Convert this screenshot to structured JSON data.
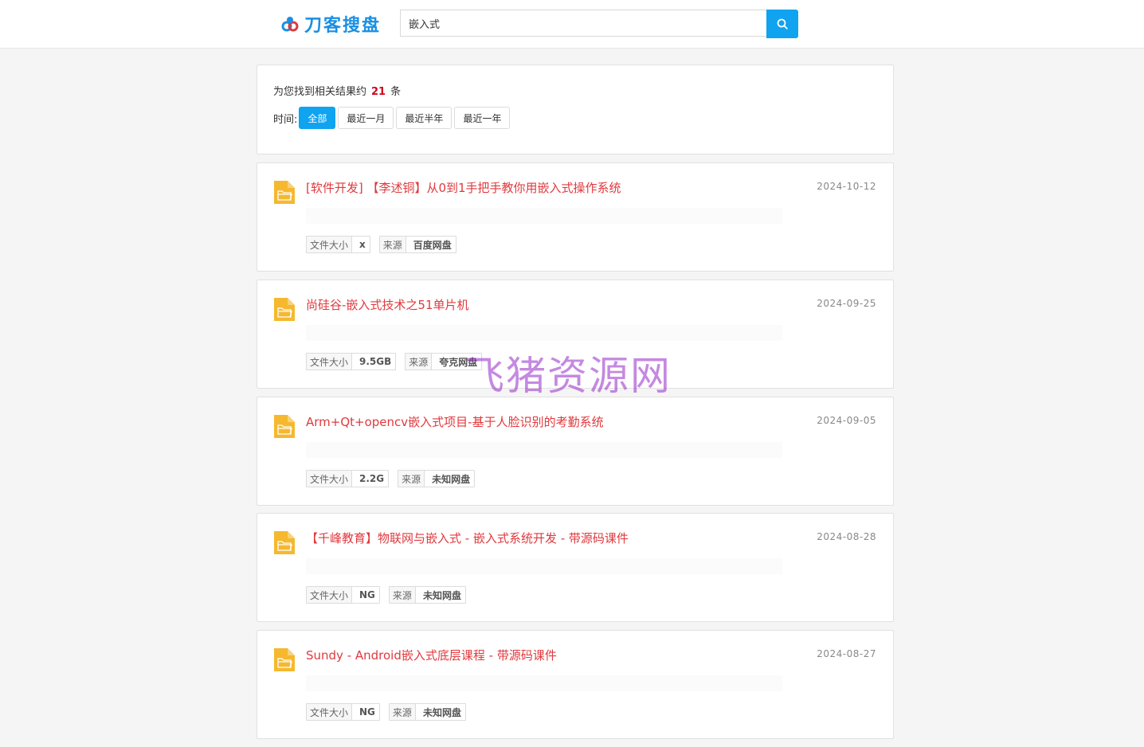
{
  "header": {
    "logo_text": "刀客搜盘",
    "search_value": "嵌入式",
    "search_icon": "search-icon"
  },
  "summary": {
    "prefix": "为您找到相关结果约",
    "count": "21",
    "suffix": "条",
    "time_label": "时间:",
    "filters": [
      "全部",
      "最近一月",
      "最近半年",
      "最近一年"
    ],
    "active_filter": "全部"
  },
  "results": [
    {
      "title": "[软件开发] 【李述铜】从0到1手把手教你用嵌入式操作系统",
      "date": "2024-10-12",
      "size_label": "文件大小",
      "size": "x",
      "source_label": "来源",
      "source": "百度网盘"
    },
    {
      "title": "尚硅谷-嵌入式技术之51单片机",
      "date": "2024-09-25",
      "size_label": "文件大小",
      "size": "9.5GB",
      "source_label": "来源",
      "source": "夸克网盘"
    },
    {
      "title": "Arm+Qt+opencv嵌入式项目-基于人脸识别的考勤系统",
      "date": "2024-09-05",
      "size_label": "文件大小",
      "size": "2.2G",
      "source_label": "来源",
      "source": "未知网盘"
    },
    {
      "title": "【千峰教育】物联网与嵌入式 - 嵌入式系统开发 - 带源码课件",
      "date": "2024-08-28",
      "size_label": "文件大小",
      "size": "NG",
      "source_label": "来源",
      "source": "未知网盘"
    },
    {
      "title": "Sundy - Android嵌入式底层课程 - 带源码课件",
      "date": "2024-08-27",
      "size_label": "文件大小",
      "size": "NG",
      "source_label": "来源",
      "source": "未知网盘"
    }
  ],
  "watermark": "飞猪资源网",
  "colors": {
    "accent": "#0fa3f0",
    "title_red": "#e0393e",
    "count_red": "#d0021b",
    "folder_yellow": "#f5b82e"
  }
}
